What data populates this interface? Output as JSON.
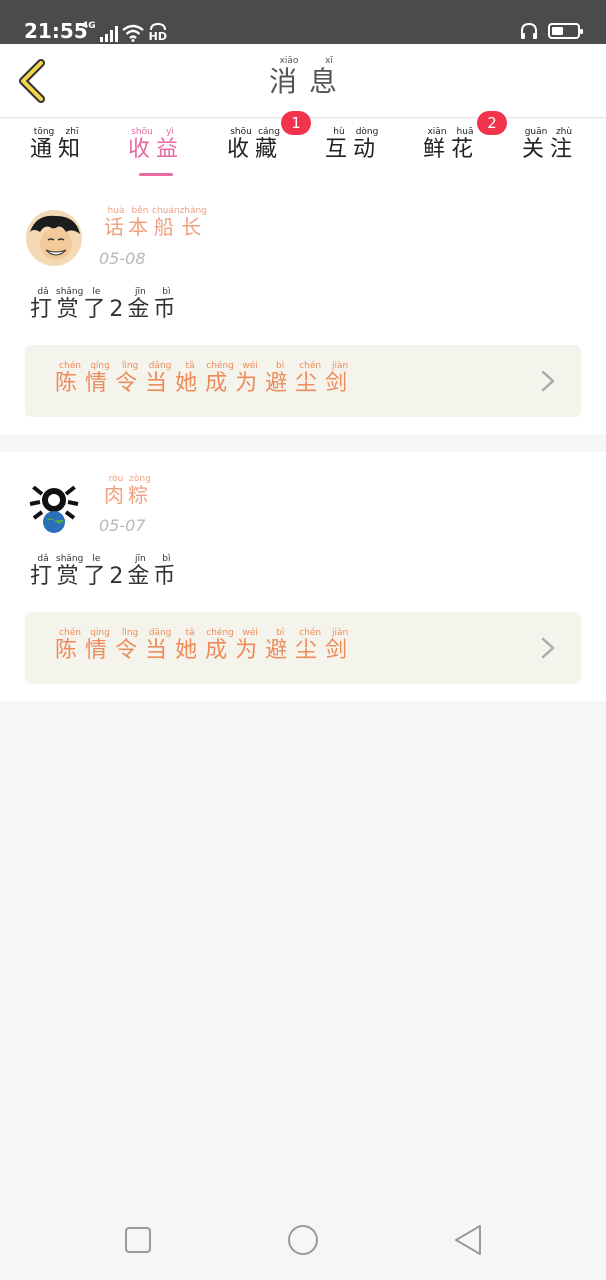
{
  "status_bar": {
    "time": "21:55",
    "network": "4G",
    "hd": "HD",
    "battery_level": 0.45
  },
  "header": {
    "title_chars": [
      {
        "han": "消",
        "pinyin": "xiāo"
      },
      {
        "han": "息",
        "pinyin": "xī"
      }
    ],
    "back_icon": "chevron-left-icon"
  },
  "tabs": [
    {
      "chars": [
        {
          "han": "通",
          "pinyin": "tōng"
        },
        {
          "han": "知",
          "pinyin": "zhī"
        }
      ],
      "active": false,
      "badge": ""
    },
    {
      "chars": [
        {
          "han": "收",
          "pinyin": "shōu"
        },
        {
          "han": "益",
          "pinyin": "yì"
        }
      ],
      "active": true,
      "badge": ""
    },
    {
      "chars": [
        {
          "han": "收",
          "pinyin": "shōu"
        },
        {
          "han": "藏",
          "pinyin": "cáng"
        }
      ],
      "active": false,
      "badge": "1"
    },
    {
      "chars": [
        {
          "han": "互",
          "pinyin": "hù"
        },
        {
          "han": "动",
          "pinyin": "dòng"
        }
      ],
      "active": false,
      "badge": ""
    },
    {
      "chars": [
        {
          "han": "鲜",
          "pinyin": "xiān"
        },
        {
          "han": "花",
          "pinyin": "huā"
        }
      ],
      "active": false,
      "badge": "2"
    },
    {
      "chars": [
        {
          "han": "关",
          "pinyin": "guān"
        },
        {
          "han": "注",
          "pinyin": "zhù"
        }
      ],
      "active": false,
      "badge": ""
    }
  ],
  "messages": [
    {
      "username": [
        {
          "han": "话",
          "pinyin": "huà"
        },
        {
          "han": "本",
          "pinyin": "běn"
        },
        {
          "han": "船",
          "pinyin": "chuán"
        },
        {
          "han": "长",
          "pinyin": "zhǎng"
        }
      ],
      "date": "05-08",
      "text": [
        {
          "han": "打",
          "pinyin": "dǎ"
        },
        {
          "han": "赏",
          "pinyin": "shǎng"
        },
        {
          "han": "了",
          "pinyin": "le"
        },
        {
          "han": "2",
          "pinyin": ""
        },
        {
          "han": "金",
          "pinyin": "jīn"
        },
        {
          "han": "币",
          "pinyin": "bì"
        }
      ],
      "link": [
        {
          "han": "陈",
          "pinyin": "chén"
        },
        {
          "han": "情",
          "pinyin": "qíng"
        },
        {
          "han": "令",
          "pinyin": "lìng"
        },
        {
          "han": "当",
          "pinyin": "dāng"
        },
        {
          "han": "她",
          "pinyin": "tā"
        },
        {
          "han": "成",
          "pinyin": "chéng"
        },
        {
          "han": "为",
          "pinyin": "wéi"
        },
        {
          "han": "避",
          "pinyin": "bì"
        },
        {
          "han": "尘",
          "pinyin": "chén"
        },
        {
          "han": "剑",
          "pinyin": "jiàn"
        }
      ]
    },
    {
      "username": [
        {
          "han": "肉",
          "pinyin": "ròu"
        },
        {
          "han": "粽",
          "pinyin": "zòng"
        }
      ],
      "date": "05-07",
      "text": [
        {
          "han": "打",
          "pinyin": "dǎ"
        },
        {
          "han": "赏",
          "pinyin": "shǎng"
        },
        {
          "han": "了",
          "pinyin": "le"
        },
        {
          "han": "2",
          "pinyin": ""
        },
        {
          "han": "金",
          "pinyin": "jīn"
        },
        {
          "han": "币",
          "pinyin": "bì"
        }
      ],
      "link": [
        {
          "han": "陈",
          "pinyin": "chén"
        },
        {
          "han": "情",
          "pinyin": "qíng"
        },
        {
          "han": "令",
          "pinyin": "lìng"
        },
        {
          "han": "当",
          "pinyin": "dāng"
        },
        {
          "han": "她",
          "pinyin": "tā"
        },
        {
          "han": "成",
          "pinyin": "chéng"
        },
        {
          "han": "为",
          "pinyin": "wéi"
        },
        {
          "han": "避",
          "pinyin": "bì"
        },
        {
          "han": "尘",
          "pinyin": "chén"
        },
        {
          "han": "剑",
          "pinyin": "jiàn"
        }
      ]
    }
  ],
  "nav": {
    "recent_icon": "square-icon",
    "home_icon": "circle-icon",
    "back_icon": "triangle-back-icon"
  },
  "colors": {
    "accent": "#e86aa2",
    "badge": "#f2334c",
    "link_text": "#ed8c5a",
    "username": "#f0a080"
  }
}
